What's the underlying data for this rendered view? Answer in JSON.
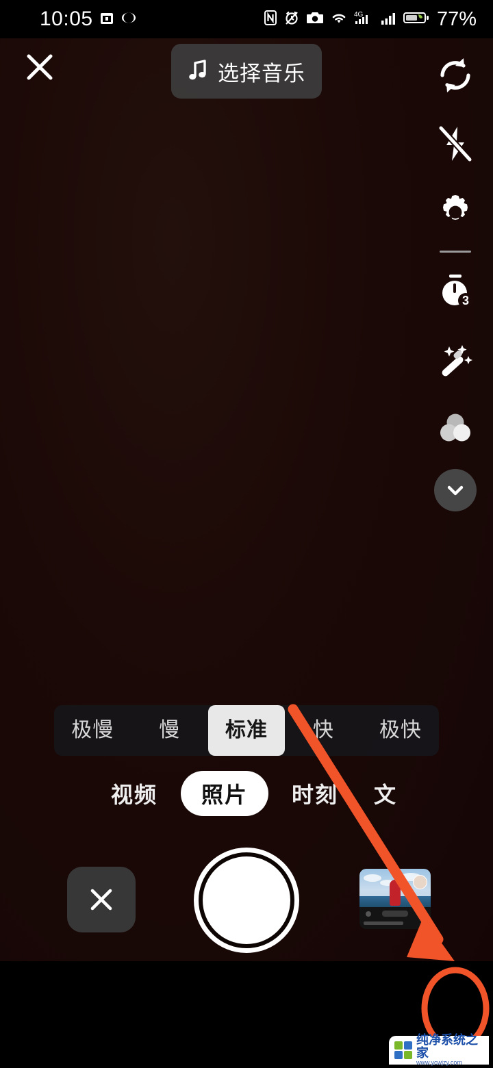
{
  "status_bar": {
    "time": "10:05",
    "battery_percent": "77%",
    "network_type": "4G",
    "icons": [
      "calendar-icon",
      "eye-comfort-icon",
      "nfc-icon",
      "alarm-muted-icon",
      "camera-icon",
      "wifi-icon",
      "signal-bars-icon",
      "battery-saver-icon"
    ]
  },
  "top_bar": {
    "close_label": "×",
    "close_icon": "close-icon",
    "music_label": "选择音乐",
    "music_icon": "music-note-icon"
  },
  "right_rail": {
    "items": [
      {
        "icon": "camera-flip-icon",
        "name": "switch-camera"
      },
      {
        "icon": "flash-off-icon",
        "name": "flash-off"
      },
      {
        "icon": "gear-icon",
        "name": "settings"
      },
      {
        "icon": "timer-icon",
        "name": "timer",
        "badge": "3"
      },
      {
        "icon": "magic-wand-icon",
        "name": "beauty"
      },
      {
        "icon": "color-filters-icon",
        "name": "filters"
      }
    ],
    "collapse_icon": "chevron-down-icon"
  },
  "speed_bar": {
    "options": [
      {
        "label": "极慢",
        "selected": false
      },
      {
        "label": "慢",
        "selected": false
      },
      {
        "label": "标准",
        "selected": true
      },
      {
        "label": "快",
        "selected": false
      },
      {
        "label": "极快",
        "selected": false
      }
    ]
  },
  "mode_bar": {
    "modes": [
      {
        "label": "视频",
        "selected": false,
        "clipped": false
      },
      {
        "label": "照片",
        "selected": true,
        "clipped": false
      },
      {
        "label": "时刻",
        "selected": false,
        "clipped": false
      },
      {
        "label": "文字",
        "selected": false,
        "clipped": true
      }
    ]
  },
  "capture_row": {
    "cancel_icon": "close-icon",
    "cancel_label": "×",
    "shutter_name": "shutter-button",
    "gallery_name": "gallery-thumbnail"
  },
  "effects_bar": {
    "favorites_icon": "star-icon",
    "items": [
      {
        "name": "effect-none",
        "icon": "no-effect-icon",
        "selected": true
      },
      {
        "name": "effect-girl",
        "icon": "cartoon-girl-thumbnail",
        "selected": false
      },
      {
        "name": "effect-pig",
        "icon": "pig-plush-thumbnail",
        "selected": false
      },
      {
        "name": "effect-search",
        "icon": "search-sparkle-icon",
        "selected": false
      }
    ]
  },
  "annotation": {
    "color": "#f2542a",
    "arrow_name": "annotation-arrow",
    "highlight_name": "annotation-ellipse",
    "target": "effect-search"
  },
  "watermark": {
    "title": "纯净系统之家",
    "url": "www.ycwjzy.com",
    "logo_colors": [
      "#7ab829",
      "#2f6fc4",
      "#2f6fc4",
      "#7ab829"
    ]
  },
  "colors": {
    "viewfinder_bg": "#1b0907",
    "bottom_bg": "#000000",
    "accent": "#f2542a",
    "selected_pill": "#ffffff"
  }
}
